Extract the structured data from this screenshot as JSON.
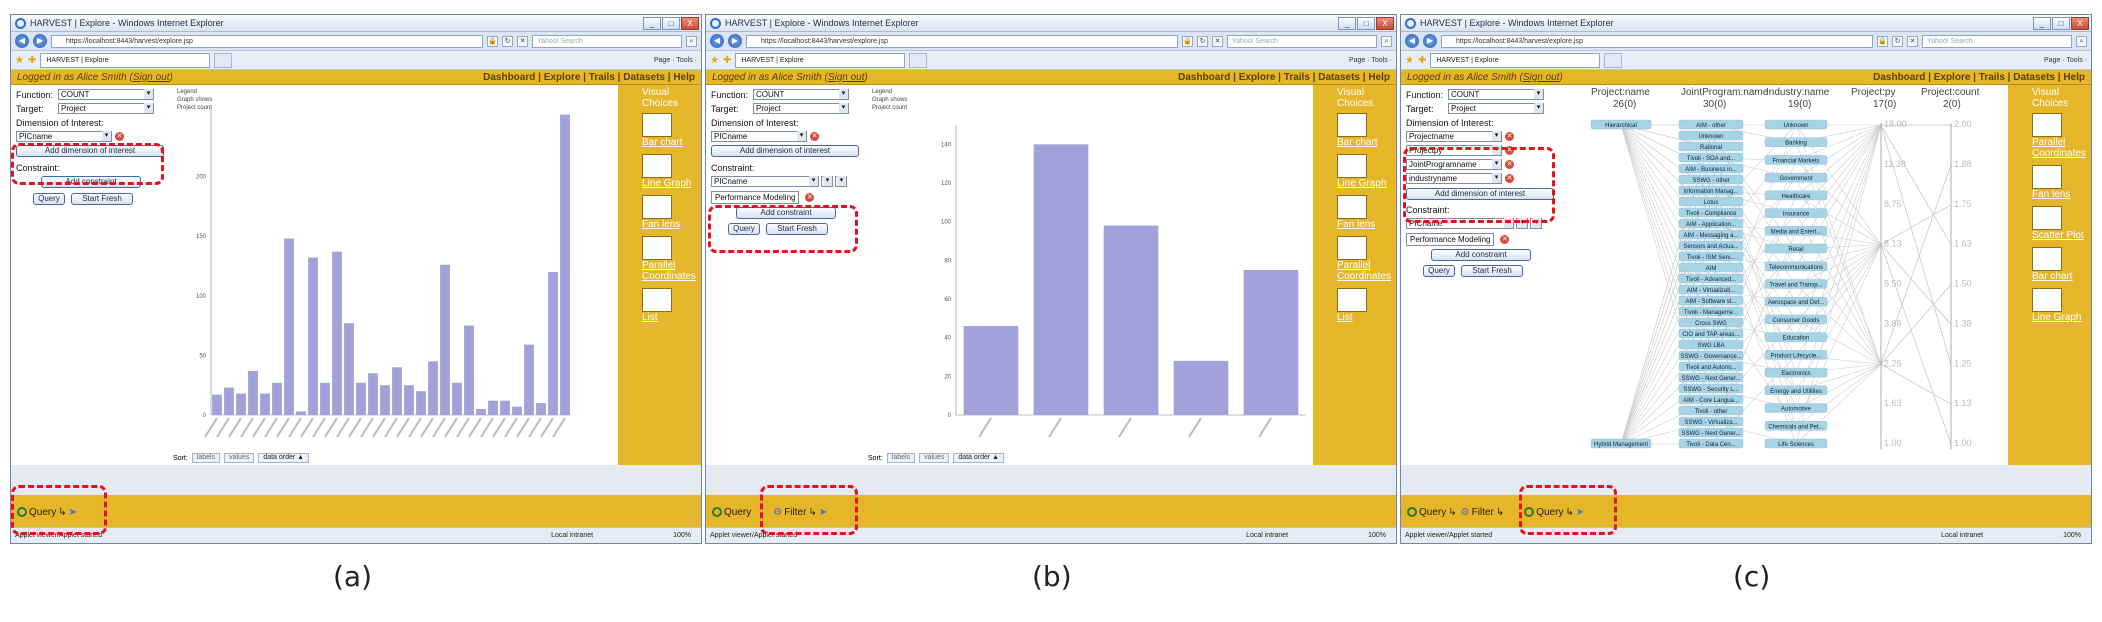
{
  "browser": {
    "window_title": "HARVEST | Explore - Windows Internet Explorer",
    "url": "https://localhost:8443/harvest/explore.jsp",
    "search_placeholder": "Yahoo! Search",
    "tab_label": "HARVEST | Explore",
    "ie_tools": "Page · Tools ·",
    "status_left": "Applet viewer/Applet started",
    "status_zone": "Local intranet",
    "status_zoom": "100%",
    "win_min": "_",
    "win_max": "□",
    "win_close": "X"
  },
  "app": {
    "logged_in_prefix": "Logged in as Alice Smith (",
    "sign_out": "Sign out",
    "logged_in_suffix": ")",
    "nav": [
      "Dashboard",
      "Explore",
      "Trails",
      "Datasets",
      "Help"
    ],
    "nav_sep": " | "
  },
  "labels": {
    "function": "Function:",
    "target": "Target:",
    "dimension": "Dimension of Interest:",
    "constraint": "Constraint:",
    "add_dimension": "Add dimension of interest",
    "add_constraint": "Add constraint",
    "query_btn": "Query",
    "start_fresh": "Start Fresh",
    "legend_title": "Legend",
    "legend_line1": "Graph shows",
    "legend_line2": "Project count",
    "sort": "Sort:",
    "sort_labels": "labels",
    "sort_values": "values",
    "sort_data_order": "data order ▲",
    "visual_choices": "Visual Choices"
  },
  "panels": [
    {
      "caption": "(a)",
      "function_value": "COUNT",
      "target_value": "Project",
      "dimensions": [
        "PICname"
      ],
      "visual_choices": [
        "Bar chart",
        "Line Graph",
        "Fan lens",
        "Parallel Coordinates",
        "List"
      ],
      "bottom_buttons": [
        "Query"
      ]
    },
    {
      "caption": "(b)",
      "function_value": "COUNT",
      "target_value": "Project",
      "dimensions": [
        "PICname"
      ],
      "constraint_field": "PICname",
      "constraint_op": "=",
      "constraint_value": "Performance Modeling",
      "visual_choices": [
        "Bar chart",
        "Line Graph",
        "Fan lens",
        "Parallel Coordinates",
        "List"
      ],
      "bottom_buttons": [
        "Query",
        "Filter"
      ]
    },
    {
      "caption": "(c)",
      "function_value": "COUNT",
      "target_value": "Project",
      "dimensions": [
        "Projectname",
        "Projectpy",
        "JointProgramname",
        "industryname"
      ],
      "constraint_field": "PICname",
      "constraint_op": "=",
      "constraint_value": "Performance Modeling",
      "visual_choices": [
        "Parallel Coordinates",
        "Fan lens",
        "Scatter Plot",
        "Bar chart",
        "Line Graph"
      ],
      "bottom_buttons": [
        "Query",
        "Filter",
        "Query"
      ]
    }
  ],
  "chart_data": [
    {
      "type": "bar",
      "values": [
        17,
        23,
        18,
        37,
        18,
        27,
        148,
        3,
        132,
        27,
        137,
        77,
        27,
        35,
        25,
        40,
        25,
        20,
        45,
        126,
        27,
        75,
        5,
        12,
        12,
        7,
        59,
        10,
        120,
        252
      ],
      "ylim": [
        0,
        260
      ],
      "yticks": [
        0,
        50,
        100,
        150,
        200
      ],
      "bar_color": "#a3a1d9"
    },
    {
      "type": "bar",
      "values": [
        46,
        140,
        98,
        28,
        75
      ],
      "ylim": [
        0,
        150
      ],
      "yticks": [
        0,
        20,
        40,
        60,
        80,
        100,
        120,
        140
      ],
      "bar_color": "#a3a1d9"
    },
    {
      "type": "parallel-coordinates",
      "axes": [
        "Project:name",
        "JointProgram:name",
        "Industry:name",
        "Project:py",
        "Project:count"
      ],
      "axis_counts": [
        "26(0)",
        "30(0)",
        "19(0)",
        "17(0)",
        "2(0)"
      ],
      "industry_values": [
        "Unknown",
        "Banking",
        "Financial Markets",
        "Government",
        "Healthcare",
        "Insurance",
        "Media and Entert...",
        "Retail",
        "Telecommunications",
        "Travel and Transp...",
        "Aerospace and Def...",
        "Consumer Goods",
        "Education",
        "Product Lifecycle...",
        "Electronics",
        "Energy and Utilities",
        "Automotive",
        "Chemicals and Pet...",
        "Life Sciences"
      ],
      "program_values": [
        "AIM - other",
        "Unknown",
        "Rational",
        "Tivoli - SOA and...",
        "AIM - Business in...",
        "SSWG - other",
        "Information Manag...",
        "Lotus",
        "Tivoli - Compliance",
        "AIM - Application...",
        "AIM - Messaging a...",
        "Sensors and Actua...",
        "Tivoli - ISM Serv...",
        "AIM",
        "Tivoli - Advanced...",
        "AIM - Virtualizati...",
        "AIM - Software st...",
        "Tivoli - Manageme...",
        "Cross SWG",
        "CIO and TAP-areas...",
        "SWG LBA",
        "SSWG - Governance...",
        "Tivoli and Autono...",
        "SSWG - Next Gener...",
        "SSWG - Security L...",
        "AIM - Core Langua...",
        "Tivoli - other",
        "SSWG - Virtualiza...",
        "SSWG - Next Gener...",
        "Tivoli - Data Cen..."
      ],
      "project_values": [
        "Hierarchical",
        "Hybrid Management"
      ],
      "py_ticks": [
        "18.00",
        "11.38",
        "8.75",
        "8.13",
        "5.50",
        "3.88",
        "2.25",
        "1.63",
        "1.00"
      ],
      "count_ticks": [
        "2.00",
        "1.88",
        "1.75",
        "1.63",
        "1.50",
        "1.38",
        "1.25",
        "1.13",
        "1.00"
      ]
    }
  ]
}
